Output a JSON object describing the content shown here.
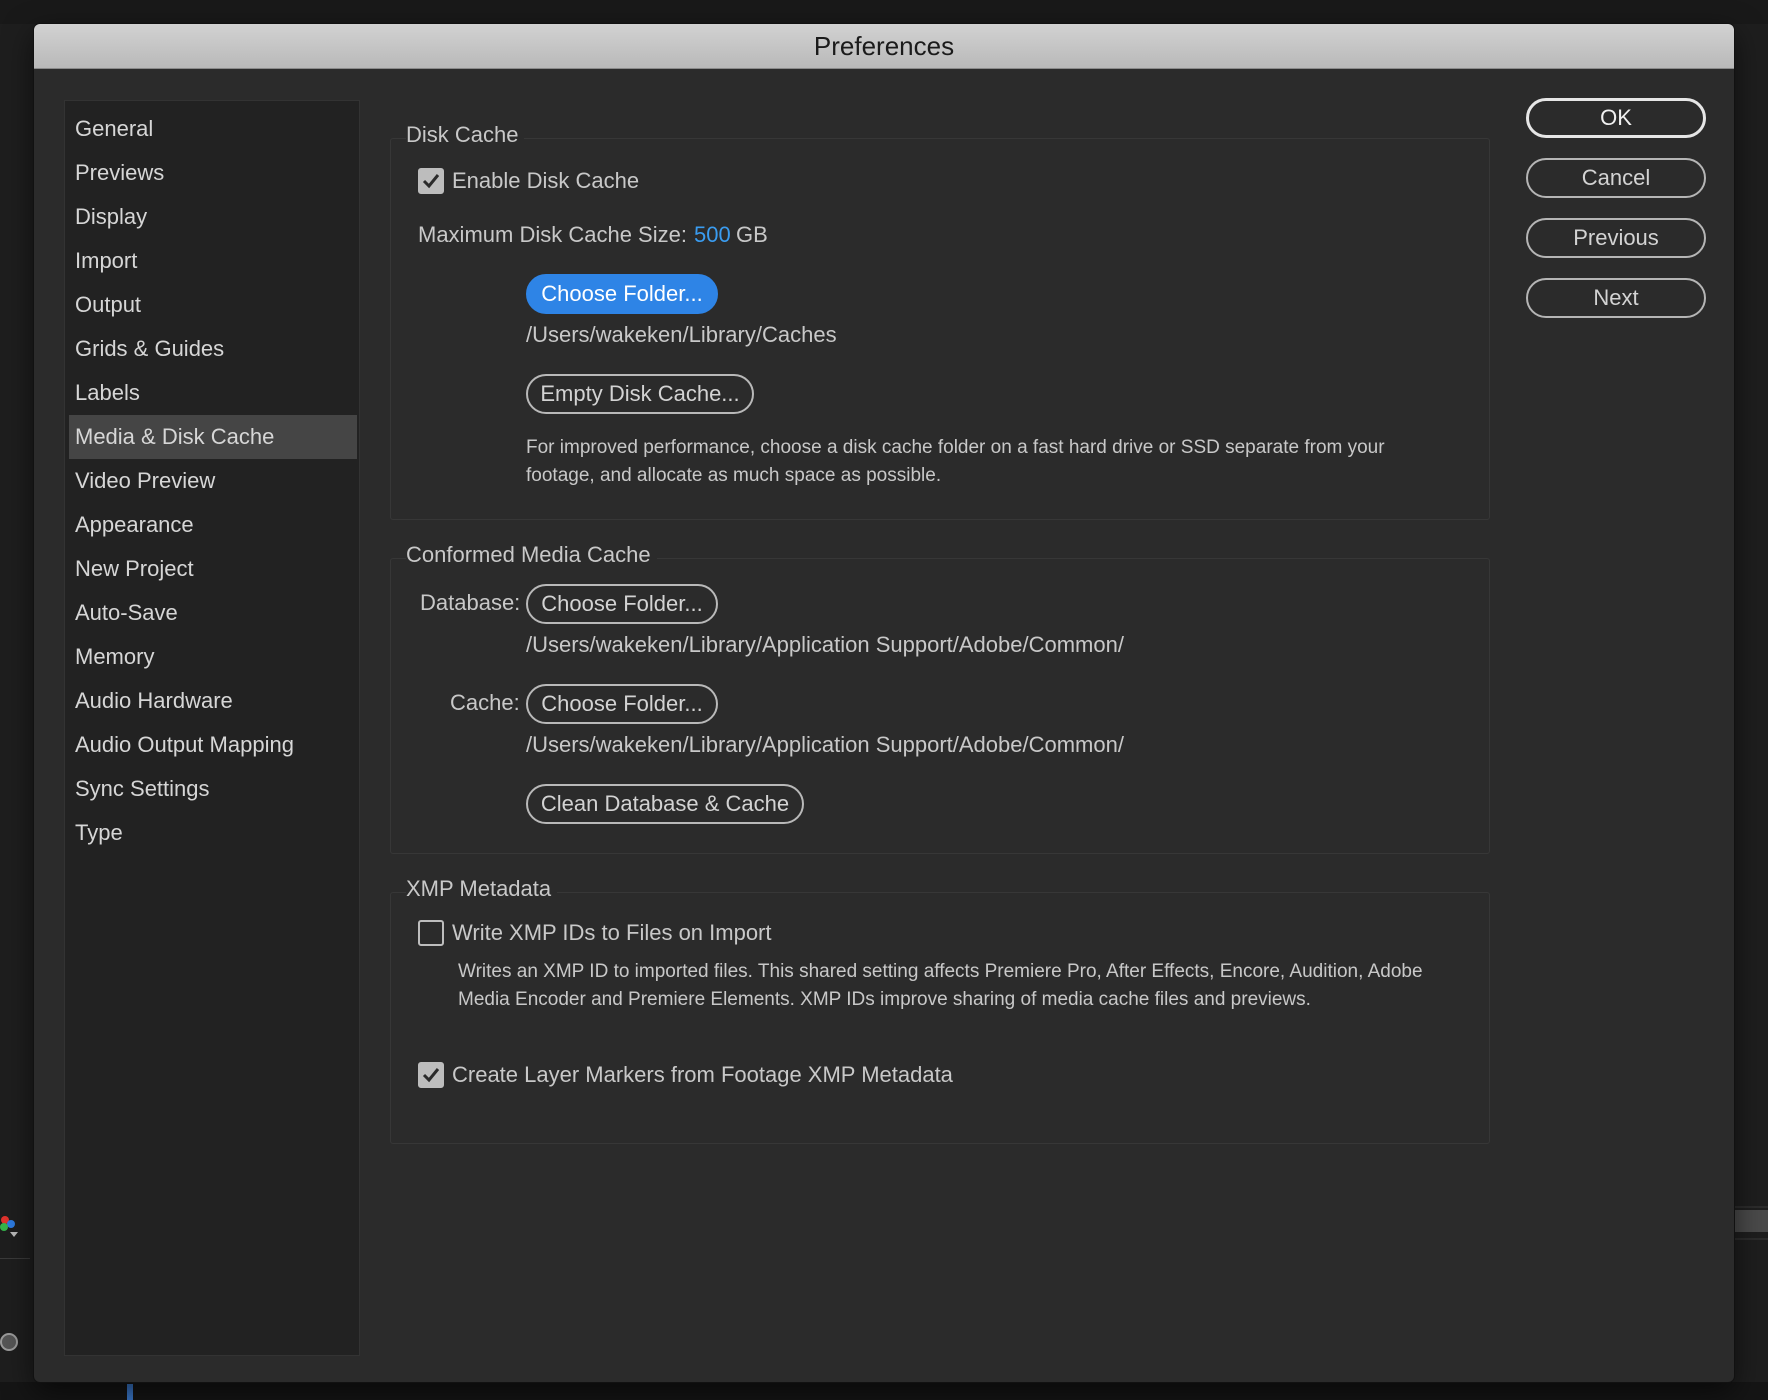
{
  "window": {
    "title": "Preferences"
  },
  "sidebar": {
    "items": [
      {
        "label": "General"
      },
      {
        "label": "Previews"
      },
      {
        "label": "Display"
      },
      {
        "label": "Import"
      },
      {
        "label": "Output"
      },
      {
        "label": "Grids & Guides"
      },
      {
        "label": "Labels"
      },
      {
        "label": "Media & Disk Cache",
        "selected": true
      },
      {
        "label": "Video Preview"
      },
      {
        "label": "Appearance"
      },
      {
        "label": "New Project"
      },
      {
        "label": "Auto-Save"
      },
      {
        "label": "Memory"
      },
      {
        "label": "Audio Hardware"
      },
      {
        "label": "Audio Output Mapping"
      },
      {
        "label": "Sync Settings"
      },
      {
        "label": "Type"
      }
    ]
  },
  "disk_cache": {
    "title": "Disk Cache",
    "enable_label": "Enable Disk Cache",
    "enable_checked": true,
    "max_size_label": "Maximum Disk Cache Size:",
    "max_size_value": "500",
    "max_size_unit": "GB",
    "choose_folder_label": "Choose Folder...",
    "folder_path": "/Users/wakeken/Library/Caches",
    "empty_label": "Empty Disk Cache...",
    "description": "For improved performance, choose a disk cache folder on a fast hard drive or SSD separate from your footage, and allocate as much space as possible."
  },
  "conformed_cache": {
    "title": "Conformed Media Cache",
    "database_label": "Database:",
    "database_button": "Choose Folder...",
    "database_path": "/Users/wakeken/Library/Application Support/Adobe/Common/",
    "cache_label": "Cache:",
    "cache_button": "Choose Folder...",
    "cache_path": "/Users/wakeken/Library/Application Support/Adobe/Common/",
    "clean_label": "Clean Database & Cache"
  },
  "xmp": {
    "title": "XMP Metadata",
    "write_label": "Write XMP IDs to Files on Import",
    "write_checked": false,
    "write_description": "Writes an XMP ID to imported files. This shared setting affects Premiere Pro, After Effects, Encore, Audition, Adobe Media Encoder and Premiere Elements. XMP IDs improve sharing of media cache files and previews.",
    "markers_label": "Create Layer Markers from Footage XMP Metadata",
    "markers_checked": true
  },
  "actions": {
    "ok": "OK",
    "cancel": "Cancel",
    "previous": "Previous",
    "next": "Next"
  },
  "colors": {
    "accent": "#2e84e6",
    "value_text": "#3a9cf0",
    "panel_bg": "#2b2b2b",
    "sidebar_bg": "#222222",
    "selected_bg": "#454545"
  }
}
